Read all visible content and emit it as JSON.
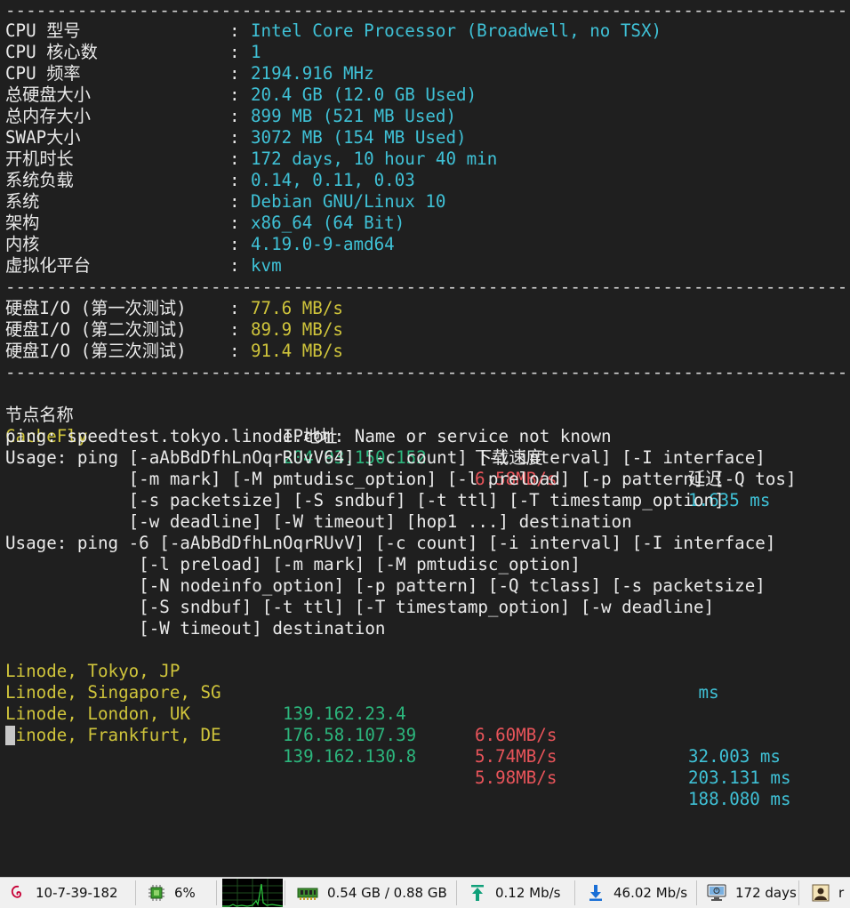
{
  "separator": "-------------------------------------------------------------------------------------------------------------------------",
  "sysinfo": [
    {
      "label": "CPU 型号",
      "value": "Intel Core Processor (Broadwell, no TSX)"
    },
    {
      "label": "CPU 核心数",
      "value": "1"
    },
    {
      "label": "CPU 频率",
      "value": "2194.916 MHz"
    },
    {
      "label": "总硬盘大小",
      "value": "20.4 GB (12.0 GB Used)"
    },
    {
      "label": "总内存大小",
      "value": "899 MB (521 MB Used)"
    },
    {
      "label": "SWAP大小",
      "value": "3072 MB (154 MB Used)"
    },
    {
      "label": "开机时长",
      "value": "172 days, 10 hour 40 min"
    },
    {
      "label": "系统负载",
      "value": "0.14, 0.11, 0.03"
    },
    {
      "label": "系统",
      "value": "Debian GNU/Linux 10"
    },
    {
      "label": "架构",
      "value": "x86_64 (64 Bit)"
    },
    {
      "label": "内核",
      "value": "4.19.0-9-amd64"
    },
    {
      "label": "虚拟化平台",
      "value": "kvm"
    }
  ],
  "colon": ":",
  "diskio": [
    {
      "label": "硬盘I/O (第一次测试)",
      "value": "77.6 MB/s"
    },
    {
      "label": "硬盘I/O (第二次测试)",
      "value": "89.9 MB/s"
    },
    {
      "label": "硬盘I/O (第三次测试)",
      "value": "91.4 MB/s"
    }
  ],
  "net_header": {
    "node": "节点名称",
    "ip": "IP地址",
    "speed": "下载速度",
    "latency": "延迟"
  },
  "cachefly": {
    "node": "CacheFly",
    "ip": "204.93.150.152",
    "speed": "6.58MB/s",
    "latency": "1.635 ms"
  },
  "ping_error": [
    "ping: speedtest.tokyo.linode.com: Name or service not known",
    "Usage: ping [-aAbBdDfhLnOqrRUvV64] [-c count] [-i interval] [-I interface]",
    "            [-m mark] [-M pmtudisc_option] [-l preload] [-p pattern] [-Q tos]",
    "            [-s packetsize] [-S sndbuf] [-t ttl] [-T timestamp_option]",
    "            [-w deadline] [-W timeout] [hop1 ...] destination",
    "Usage: ping -6 [-aAbBdDfhLnOqrRUvV] [-c count] [-i interval] [-I interface]",
    "             [-l preload] [-m mark] [-M pmtudisc_option]",
    "             [-N nodeinfo_option] [-p pattern] [-Q tclass] [-s packetsize]",
    "             [-S sndbuf] [-t ttl] [-T timestamp_option] [-w deadline]",
    "             [-W timeout] destination"
  ],
  "tokyo": {
    "node": "Linode, Tokyo, JP",
    "latency": " ms"
  },
  "linode_rows": [
    {
      "node": "Linode, Singapore, SG",
      "ip": "139.162.23.4",
      "speed": "6.60MB/s",
      "latency": "32.003 ms"
    },
    {
      "node": "Linode, London, UK",
      "ip": "176.58.107.39",
      "speed": "5.74MB/s",
      "latency": "203.131 ms"
    },
    {
      "node": "Linode, Frankfurt, DE",
      "ip": "139.162.130.8",
      "speed": "5.98MB/s",
      "latency": "188.080 ms"
    }
  ],
  "statusbar": {
    "hostname": "10-7-39-182",
    "cpu": "6%",
    "memory": "0.54 GB / 0.88 GB",
    "upload": "0.12 Mb/s",
    "download": "46.02 Mb/s",
    "uptime": "172 days",
    "user": "r",
    "icons": {
      "host": "debian-icon",
      "cpu": "cpu-chip-icon",
      "graph": "cpu-graph",
      "memory": "ram-icon",
      "upload": "upload-arrow-icon",
      "download": "download-arrow-icon",
      "uptime": "monitor-icon",
      "user": "user-icon"
    },
    "colors": {
      "upload": "#10a07a",
      "download": "#1a6fd6",
      "debian": "#c70036",
      "graph": "#2ecc40"
    }
  }
}
